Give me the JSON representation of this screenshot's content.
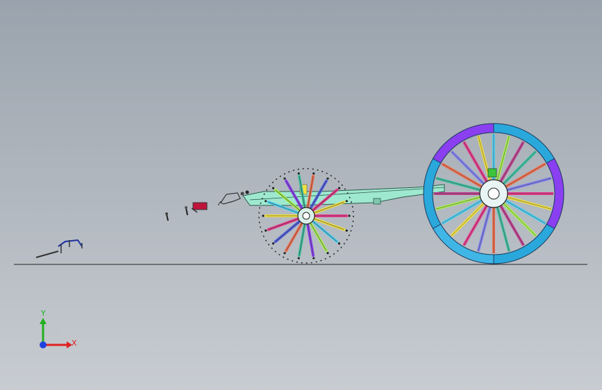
{
  "viewport": {
    "background_top": "#9aa3ad",
    "background_bottom": "#c8ccd1"
  },
  "model": {
    "components": [
      "exploded-small-parts",
      "rake-wheel",
      "frame-beam",
      "drive-wheel"
    ],
    "drive_wheel": {
      "rim_colors": [
        "#8a3ff0",
        "#3fb6e6",
        "#2aa8dc"
      ],
      "spoke_colors": [
        "#e8388a",
        "#f0e040",
        "#4fd0f0",
        "#a8f050",
        "#c04090",
        "#40c0a0",
        "#f07050",
        "#8080f0"
      ]
    },
    "rake_wheel": {
      "tine_colors": [
        "#e8388a",
        "#f0e040",
        "#4fd0f0",
        "#a8f050",
        "#8a3ff0",
        "#40c0a0",
        "#f07050",
        "#5060e0"
      ]
    }
  },
  "triad": {
    "x_label": "X",
    "y_label": "Y",
    "x_color": "#e02020",
    "y_color": "#20b020",
    "z_color": "#2040e0"
  }
}
